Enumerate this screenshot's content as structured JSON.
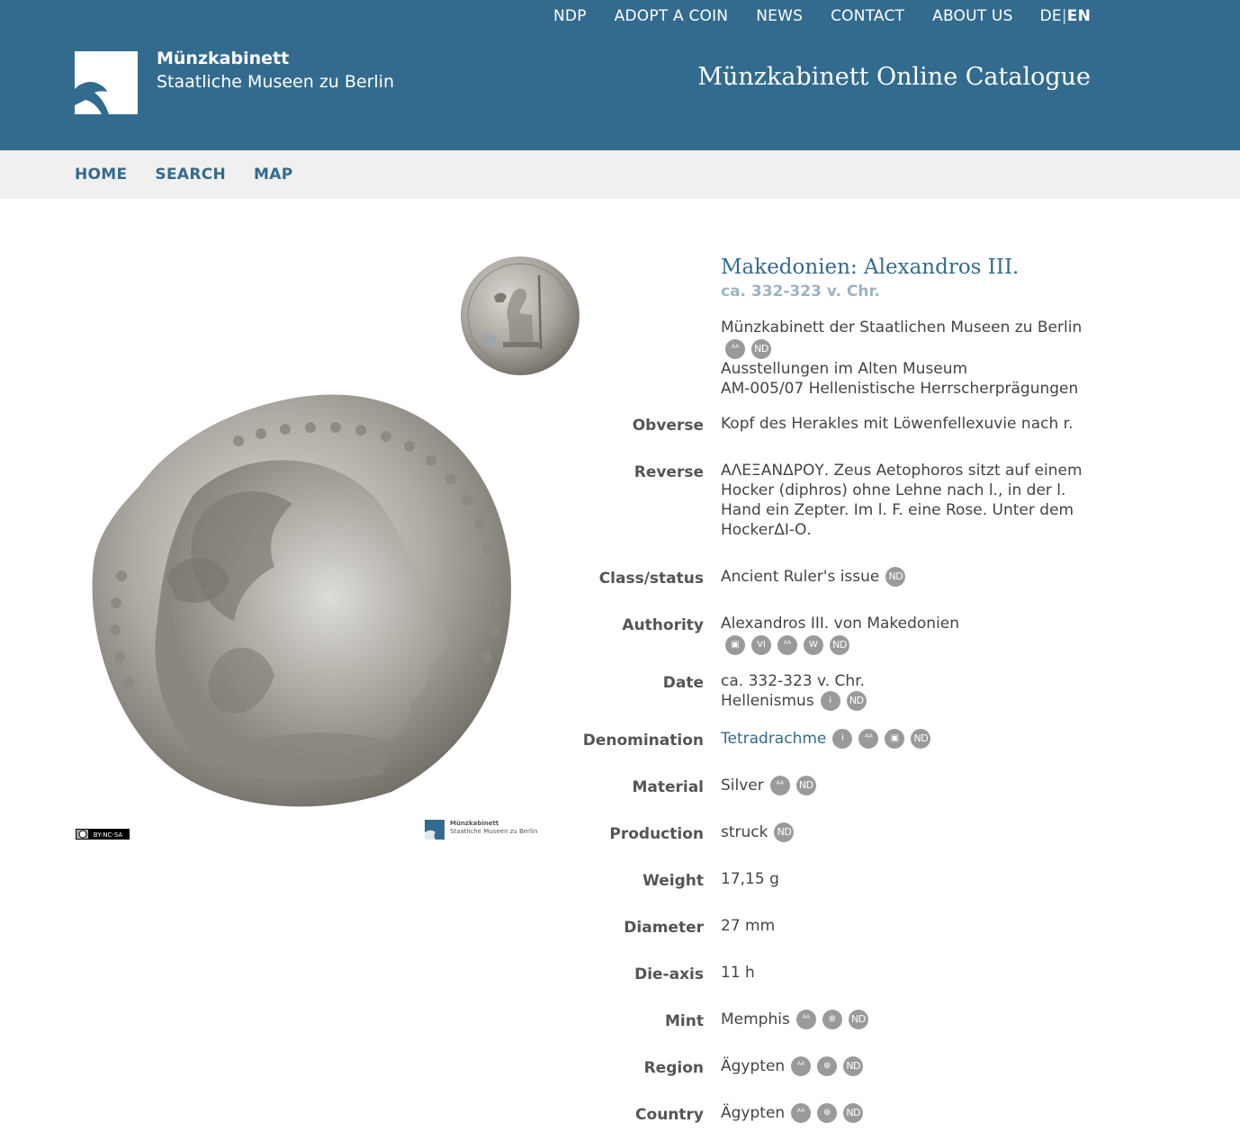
{
  "top_nav": {
    "items": [
      "NDP",
      "ADOPT A COIN",
      "NEWS",
      "CONTACT",
      "ABOUT US"
    ],
    "lang_de": "DE",
    "lang_sep": "|",
    "lang_en": "EN"
  },
  "logo": {
    "title": "Münzkabinett",
    "subtitle": "Staatliche Museen zu Berlin"
  },
  "catalogue_title": "Münzkabinett Online Catalogue",
  "sub_nav": [
    "HOME",
    "SEARCH",
    "MAP"
  ],
  "image_credits": {
    "license": "BY-NC-SA",
    "mini_logo_title": "Münzkabinett",
    "mini_logo_sub": "Staatliche Museen zu Berlin"
  },
  "coin": {
    "title": "Makedonien: Alexandros III.",
    "date": "ca. 332-323 v. Chr.",
    "collection_line1": "Münzkabinett der Staatlichen Museen zu Berlin",
    "collection_line2": "Ausstellungen im Alten Museum",
    "collection_line3": "AM-005/07 Hellenistische Herrscherprägungen"
  },
  "fields": {
    "obverse": {
      "label": "Obverse",
      "value": "Kopf des Herakles mit Löwenfellexuvie nach r."
    },
    "reverse": {
      "label": "Reverse",
      "value": "ΑΛΕΞΑΝΔΡΟΥ. Zeus Aetophoros sitzt auf einem Hocker (diphros) ohne Lehne nach l., in der l. Hand ein Zepter. Im l. F. eine Rose. Unter dem HockerΔΙ-Ο."
    },
    "class_status": {
      "label": "Class/status",
      "value": "Ancient Ruler's issue"
    },
    "authority": {
      "label": "Authority",
      "value": "Alexandros III. von Makedonien"
    },
    "date": {
      "label": "Date",
      "value": "ca. 332-323 v. Chr.",
      "value2": "Hellenismus"
    },
    "denomination": {
      "label": "Denomination",
      "value": "Tetradrachme"
    },
    "material": {
      "label": "Material",
      "value": "Silver"
    },
    "production": {
      "label": "Production",
      "value": "struck"
    },
    "weight": {
      "label": "Weight",
      "value": "17,15 g"
    },
    "diameter": {
      "label": "Diameter",
      "value": "27 mm"
    },
    "die_axis": {
      "label": "Die-axis",
      "value": "11 h"
    },
    "mint": {
      "label": "Mint",
      "value": "Memphis"
    },
    "region": {
      "label": "Region",
      "value": "Ägypten"
    },
    "country": {
      "label": "Country",
      "value": "Ägypten"
    }
  },
  "icon_labels": {
    "nd": "ND",
    "info": "i",
    "wiki": "W",
    "viaf": "VI"
  },
  "colors": {
    "header_bg": "#336b8e",
    "subnav_bg": "#f0f0f0",
    "accent": "#336b8e",
    "date_light": "#9bb4c5",
    "icon_gray": "#9a9a9a"
  }
}
